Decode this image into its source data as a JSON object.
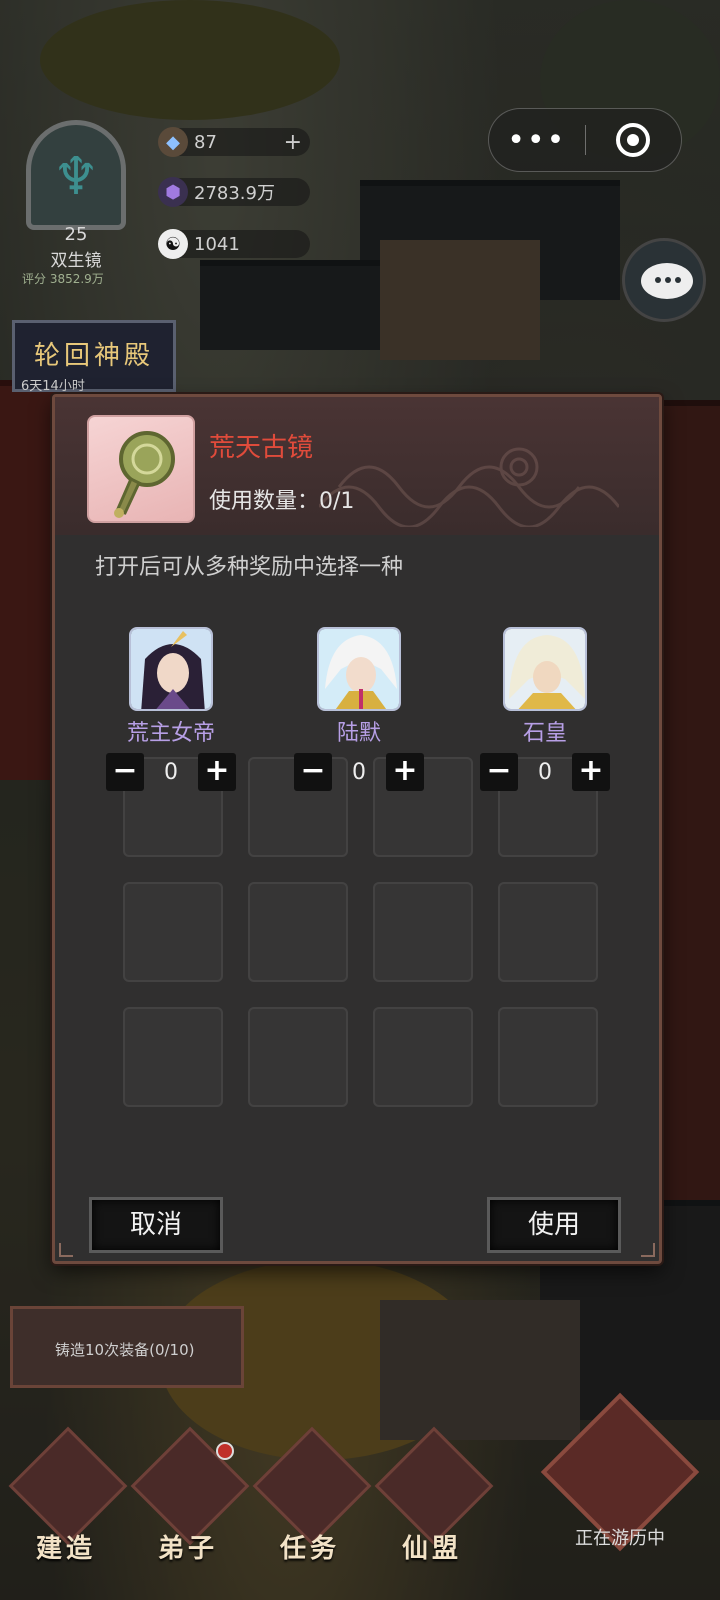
{
  "hud": {
    "avatar": {
      "level": "25",
      "name": "双生镜",
      "score": "评分 3852.9万"
    },
    "resources": [
      {
        "icon": "gem-icon",
        "value": "87",
        "has_plus": true
      },
      {
        "icon": "crystal-icon",
        "value": "2783.9万",
        "has_plus": false
      },
      {
        "icon": "yinyang-icon",
        "value": "1041",
        "has_plus": false
      }
    ],
    "temple_banner": {
      "title": "轮回神殿",
      "timer": "6天14小时"
    }
  },
  "modal": {
    "item_name": "荒天古镜",
    "usage_label": "使用数量：",
    "usage_value": "0/1",
    "description": "打开后可从多种奖励中选择一种",
    "heroes": [
      {
        "name": "荒主女帝",
        "count": "0"
      },
      {
        "name": "陆默",
        "count": "0"
      },
      {
        "name": "石皇",
        "count": "0"
      }
    ],
    "cancel_label": "取消",
    "use_label": "使用",
    "colors": {
      "item_name": "#e04b3b",
      "hero_name": "#b79fe6"
    }
  },
  "quest": {
    "text": "铸造10次装备(0/10)"
  },
  "bottom_nav": {
    "items": [
      {
        "label": "建造"
      },
      {
        "label": "弟子"
      },
      {
        "label": "任务"
      },
      {
        "label": "仙盟"
      }
    ],
    "travel_label": "正在游历中"
  }
}
